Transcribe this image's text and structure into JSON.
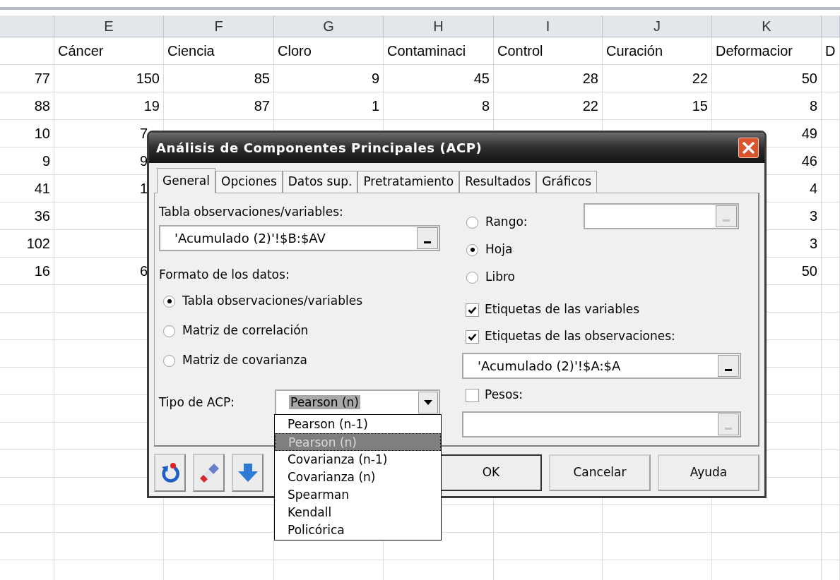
{
  "sheet": {
    "column_letters": [
      "E",
      "F",
      "G",
      "H",
      "I",
      "J",
      "K"
    ],
    "rows": [
      [
        null,
        "Cáncer",
        "Ciencia",
        "Cloro",
        "Contaminaci",
        "Control",
        "Curación",
        "Deformacior",
        "D"
      ],
      [
        "77",
        "150",
        "85",
        "9",
        "45",
        "28",
        "22",
        "50",
        null
      ],
      [
        "88",
        "19",
        "87",
        "1",
        "8",
        "22",
        "15",
        "8",
        null
      ],
      [
        "10",
        "7",
        null,
        null,
        null,
        null,
        null,
        "49",
        null
      ],
      [
        "9",
        "9",
        null,
        null,
        null,
        null,
        null,
        "46",
        null
      ],
      [
        "41",
        "1",
        null,
        null,
        null,
        null,
        null,
        "4",
        null
      ],
      [
        "36",
        null,
        null,
        null,
        null,
        null,
        null,
        "3",
        null
      ],
      [
        "102",
        null,
        null,
        null,
        null,
        null,
        null,
        "3",
        null
      ],
      [
        "16",
        "6",
        null,
        null,
        null,
        null,
        null,
        "50",
        null
      ]
    ]
  },
  "dialog": {
    "title": "Análisis de Componentes Principales (ACP)",
    "tabs": [
      {
        "label": "General",
        "selected": true
      },
      {
        "label": "Opciones",
        "selected": false
      },
      {
        "label": "Datos sup.",
        "selected": false
      },
      {
        "label": "Pretratamiento",
        "selected": false
      },
      {
        "label": "Resultados",
        "selected": false
      },
      {
        "label": "Gráficos",
        "selected": false
      }
    ],
    "table_label": "Tabla observaciones/variables:",
    "table_field": {
      "value": "'Acumulado (2)'!$B:$AV"
    },
    "format_label": "Formato de los datos:",
    "format_options": [
      {
        "label": "Tabla observaciones/variables",
        "selected": true
      },
      {
        "label": "Matriz de correlación",
        "selected": false
      },
      {
        "label": "Matriz de covarianza",
        "selected": false
      }
    ],
    "type_label": "Tipo de ACP:",
    "type_select": {
      "value": "Pearson (n)",
      "expanded": true,
      "options": [
        {
          "label": "Pearson (n-1)",
          "selected": false
        },
        {
          "label": "Pearson (n)",
          "selected": true
        },
        {
          "label": "Covarianza (n-1)",
          "selected": false
        },
        {
          "label": "Covarianza (n)",
          "selected": false
        },
        {
          "label": "Spearman",
          "selected": false
        },
        {
          "label": "Kendall",
          "selected": false
        },
        {
          "label": "Policórica",
          "selected": false
        }
      ]
    },
    "source_options": [
      {
        "label": "Rango:",
        "selected": false
      },
      {
        "label": "Hoja",
        "selected": true
      },
      {
        "label": "Libro",
        "selected": false
      }
    ],
    "right_items": [
      {
        "kind": "checkbox",
        "label": "Etiquetas de las variables",
        "checked": true
      },
      {
        "kind": "checkbox",
        "label": "Etiquetas de las observaciones:",
        "checked": true
      },
      {
        "kind": "field",
        "value": "'Acumulado (2)'!$A:$A"
      },
      {
        "kind": "checkbox",
        "label": "Pesos:",
        "checked": false
      },
      {
        "kind": "field"
      }
    ],
    "buttons": [
      "OK",
      "Cancelar",
      "Ayuda"
    ]
  }
}
